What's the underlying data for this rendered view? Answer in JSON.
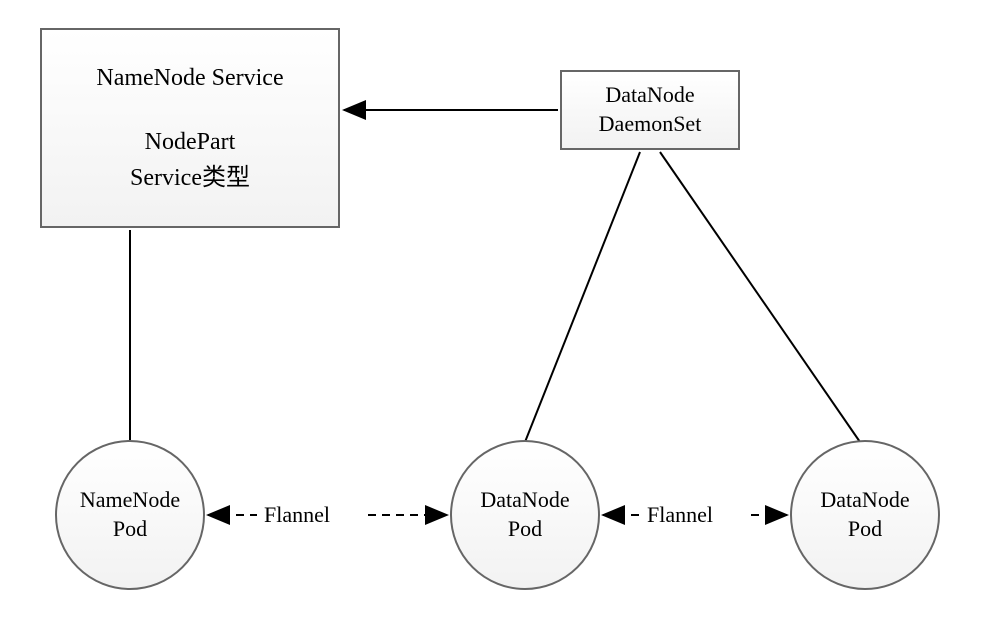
{
  "nodes": {
    "namenode_service": {
      "line1": "NameNode Service",
      "line2": "NodePart",
      "line3": "Service类型"
    },
    "datanode_daemonset": {
      "line1": "DataNode",
      "line2": "DaemonSet"
    },
    "namenode_pod": {
      "line1": "NameNode",
      "line2": "Pod"
    },
    "datanode_pod_1": {
      "line1": "DataNode",
      "line2": "Pod"
    },
    "datanode_pod_2": {
      "line1": "DataNode",
      "line2": "Pod"
    }
  },
  "edges": {
    "flannel_1": "Flannel",
    "flannel_2": "Flannel"
  }
}
